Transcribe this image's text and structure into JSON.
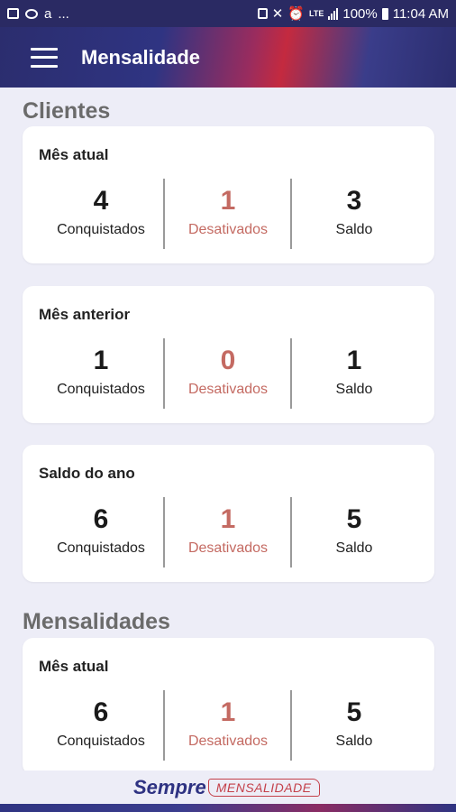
{
  "status_bar": {
    "left_extra": "...",
    "network": "LTE",
    "battery": "100%",
    "time": "11:04 AM"
  },
  "app_bar": {
    "title": "Mensalidade"
  },
  "sections": [
    {
      "title": "Clientes",
      "cards": [
        {
          "title": "Mês atual",
          "conquistados": "4",
          "desativados": "1",
          "saldo": "3"
        },
        {
          "title": "Mês anterior",
          "conquistados": "1",
          "desativados": "0",
          "saldo": "1"
        },
        {
          "title": "Saldo do ano",
          "conquistados": "6",
          "desativados": "1",
          "saldo": "5"
        }
      ]
    },
    {
      "title": "Mensalidades",
      "cards": [
        {
          "title": "Mês atual",
          "conquistados": "6",
          "desativados": "1",
          "saldo": "5"
        }
      ]
    }
  ],
  "labels": {
    "conquistados": "Conquistados",
    "desativados": "Desativados",
    "saldo": "Saldo"
  },
  "footer": {
    "brand": "Sempre",
    "product": "MENSALIDADE"
  },
  "colors": {
    "primary": "#2e3282",
    "accent": "#c42a3f",
    "negative": "#c46a62",
    "background": "#ededf7"
  }
}
